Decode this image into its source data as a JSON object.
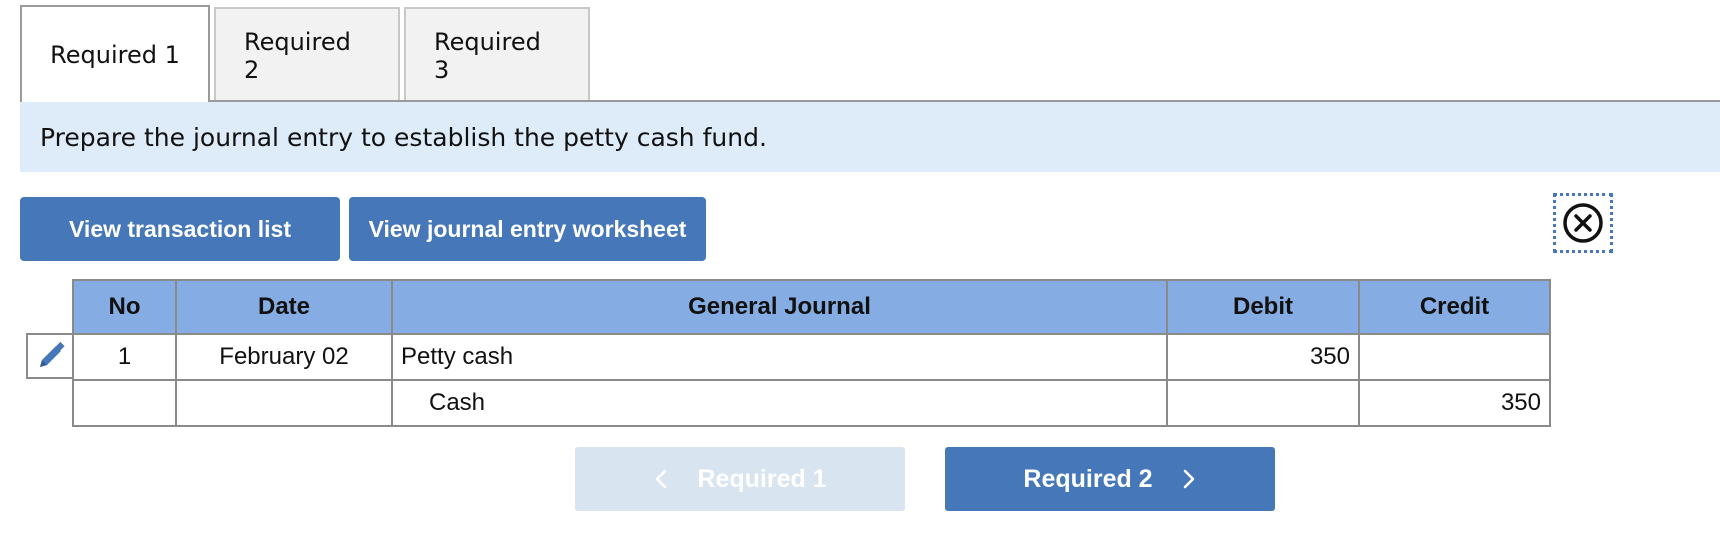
{
  "tabs": [
    {
      "label": "Required 1",
      "active": true
    },
    {
      "label": "Required 2",
      "active": false
    },
    {
      "label": "Required 3",
      "active": false
    }
  ],
  "instruction": "Prepare the journal entry to establish the petty cash fund.",
  "buttons": {
    "view_transaction_list": "View transaction list",
    "view_journal_entry_worksheet": "View journal entry worksheet"
  },
  "icons": {
    "close": "close-circle-icon",
    "edit": "pencil-icon",
    "prev": "chevron-left-icon",
    "next": "chevron-right-icon"
  },
  "table": {
    "headers": {
      "no": "No",
      "date": "Date",
      "general_journal": "General Journal",
      "debit": "Debit",
      "credit": "Credit"
    },
    "rows": [
      {
        "no": "1",
        "date": "February 02",
        "account": "Petty cash",
        "debit": "350",
        "credit": ""
      },
      {
        "no": "",
        "date": "",
        "account": "Cash",
        "debit": "",
        "credit": "350"
      }
    ]
  },
  "nav": {
    "prev_label": "Required 1",
    "next_label": "Required 2"
  },
  "colors": {
    "primary": "#4677b8",
    "header_fill": "#85ade3",
    "banner_fill": "#deebf8",
    "disabled_button": "#d9e4f1"
  }
}
